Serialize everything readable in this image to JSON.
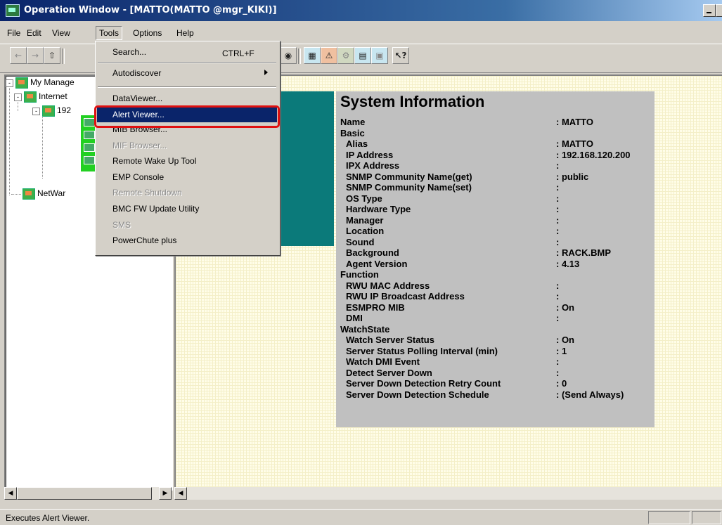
{
  "window": {
    "title": "Operation Window - [MATTO(MATTO @mgr_KIKI)]"
  },
  "menubar": {
    "items": [
      "File",
      "Edit",
      "View",
      "Tools",
      "Options",
      "Help"
    ]
  },
  "toolbar": {
    "icons": [
      "back-arrow-icon",
      "forward-arrow-icon",
      "up-folder-icon",
      "binoculars-icon",
      "map-icon",
      "alert-icon",
      "dataviewer-icon",
      "mib-icon",
      "console-icon",
      "help-pointer-icon"
    ],
    "help_glyph": "?"
  },
  "tools_menu": {
    "search": "Search...",
    "search_shortcut": "CTRL+F",
    "autodiscover": "Autodiscover",
    "dataviewer": "DataViewer...",
    "alert_viewer": "Alert Viewer...",
    "mib_browser": "MIB Browser...",
    "mif_browser": "MIF Browser...",
    "remote_wake_up": "Remote Wake Up Tool",
    "emp_console": "EMP Console",
    "remote_shutdown": "Remote Shutdown",
    "bmc_fw_update": "BMC FW Update Utility",
    "sms": "SMS",
    "powerchute": "PowerChute plus"
  },
  "tree": {
    "root": "My Manage",
    "internet": "Internet",
    "ip_node": "192",
    "netware": "NetWar"
  },
  "sysinfo": {
    "title": "System Information",
    "rows": [
      {
        "label": "Name",
        "value": ": MATTO",
        "indent": 0
      },
      {
        "label": "Basic",
        "value": "",
        "indent": 0
      },
      {
        "label": "Alias",
        "value": ": MATTO",
        "indent": 1
      },
      {
        "label": "IP Address",
        "value": ": 192.168.120.200",
        "indent": 1
      },
      {
        "label": "IPX Address",
        "value": ":",
        "indent": 1
      },
      {
        "label": "SNMP Community Name(get)",
        "value": ": public",
        "indent": 1
      },
      {
        "label": "SNMP Community Name(set)",
        "value": ":",
        "indent": 1
      },
      {
        "label": "OS Type",
        "value": ":",
        "indent": 1
      },
      {
        "label": "Hardware Type",
        "value": ":",
        "indent": 1
      },
      {
        "label": "Manager",
        "value": ":",
        "indent": 1
      },
      {
        "label": "Location",
        "value": ":",
        "indent": 1
      },
      {
        "label": "Sound",
        "value": ":",
        "indent": 1
      },
      {
        "label": "Background",
        "value": ": RACK.BMP",
        "indent": 1
      },
      {
        "label": "Agent Version",
        "value": ": 4.13",
        "indent": 1
      },
      {
        "label": "Function",
        "value": "",
        "indent": 0
      },
      {
        "label": "RWU MAC Address",
        "value": ":",
        "indent": 1
      },
      {
        "label": "RWU IP Broadcast Address",
        "value": ":",
        "indent": 1
      },
      {
        "label": "ESMPRO MIB",
        "value": ": On",
        "indent": 1
      },
      {
        "label": "DMI",
        "value": ":",
        "indent": 1
      },
      {
        "label": "WatchState",
        "value": "",
        "indent": 0
      },
      {
        "label": "Watch Server Status",
        "value": ": On",
        "indent": 1
      },
      {
        "label": "Server Status Polling Interval (min)",
        "value": ": 1",
        "indent": 1
      },
      {
        "label": "Watch DMI Event",
        "value": ":",
        "indent": 1
      },
      {
        "label": "Detect Server Down",
        "value": ":",
        "indent": 1
      },
      {
        "label": "Server Down Detection Retry Count",
        "value": ": 0",
        "indent": 1
      },
      {
        "label": "Server Down Detection Schedule",
        "value": ": (Send Always)",
        "indent": 1
      }
    ]
  },
  "statusbar": {
    "text": "Executes Alert Viewer."
  },
  "colors": {
    "highlight_border": "#e01010",
    "menu_selection": "#0a246a",
    "teal_panel": "#0b7a7a"
  }
}
